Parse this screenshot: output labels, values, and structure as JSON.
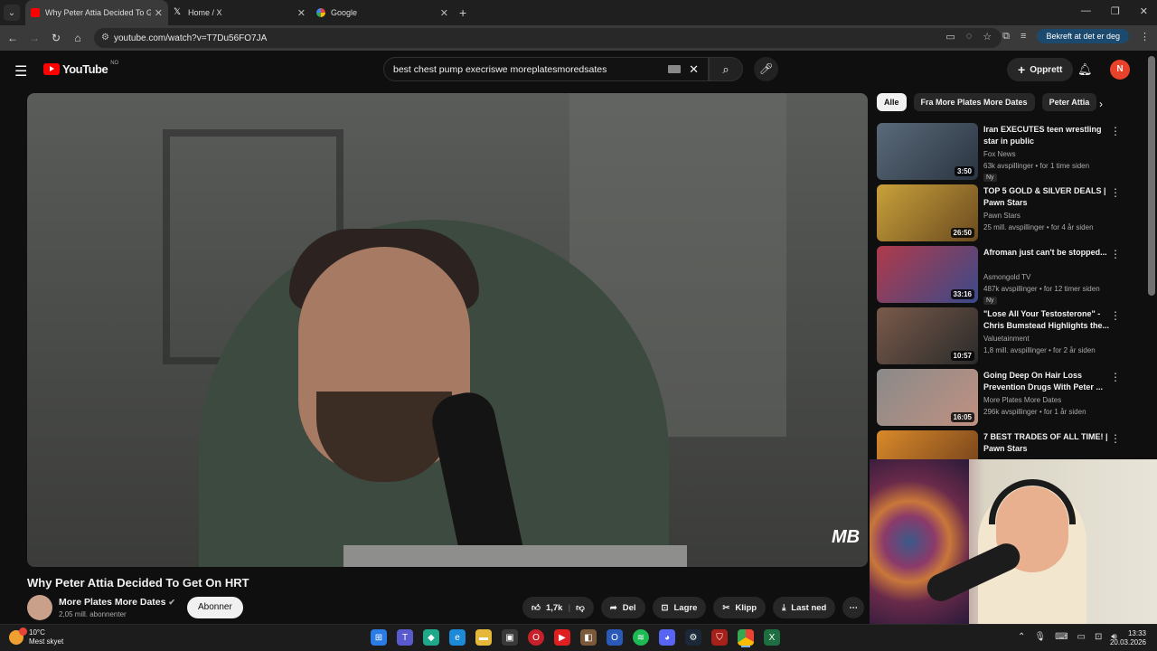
{
  "browser": {
    "tabs": [
      {
        "title": "Why Peter Attia Decided To Ge",
        "icon": "youtube-icon",
        "active": true
      },
      {
        "title": "Home / X",
        "icon": "x-icon",
        "active": false
      },
      {
        "title": "Google",
        "icon": "google-icon",
        "active": false
      }
    ],
    "url": "youtube.com/watch?v=T7Du56FO7JA",
    "verify_label": "Bekreft at det er deg"
  },
  "youtube": {
    "logo_text": "YouTube",
    "country_code": "NO",
    "search_value": "best chest pump execriswe moreplatesmoredsates",
    "create_label": "Opprett",
    "avatar_letter": "N",
    "accent": "#ff0000"
  },
  "video": {
    "title": "Why Peter Attia Decided To Get On HRT",
    "channel": "More Plates More Dates",
    "subscribers": "2,05 mill. abonnenter",
    "subscribe_label": "Abonner",
    "likes": "1,7k",
    "share_label": "Del",
    "save_label": "Lagre",
    "clip_label": "Klipp",
    "download_label": "Last ned",
    "watermark": "MB"
  },
  "chips": [
    "Alle",
    "Fra More Plates More Dates",
    "Peter Attia"
  ],
  "related": [
    {
      "title": "Iran EXECUTES teen wrestling star in public",
      "channel": "Fox News",
      "meta": "63k avspillinger • for 1 time siden",
      "badge": "Ny",
      "duration": "3:50",
      "colors": [
        "#5a6a7a",
        "#2a3440"
      ]
    },
    {
      "title": "TOP 5 GOLD & SILVER DEALS | Pawn Stars",
      "channel": "Pawn Stars",
      "meta": "25 mill. avspillinger • for 4 år siden",
      "badge": "",
      "duration": "26:50",
      "colors": [
        "#c9a13a",
        "#6a4a20"
      ]
    },
    {
      "title": "Afroman just can't be stopped...",
      "channel": "Asmongold TV",
      "meta": "487k avspillinger • for 12 timer siden",
      "badge": "Ny",
      "duration": "33:16",
      "colors": [
        "#b03a4a",
        "#3a4a8a"
      ]
    },
    {
      "title": "\"Lose All Your Testosterone\" - Chris Bumstead Highlights the...",
      "channel": "Valuetainment",
      "meta": "1,8 mill. avspillinger • for 2 år siden",
      "badge": "",
      "duration": "10:57",
      "colors": [
        "#7a5a4a",
        "#2a2a2a"
      ]
    },
    {
      "title": "Going Deep On Hair Loss Prevention Drugs With Peter ...",
      "channel": "More Plates More Dates",
      "meta": "296k avspillinger • for 1 år siden",
      "badge": "",
      "duration": "16:05",
      "colors": [
        "#8a8a8a",
        "#c09080"
      ]
    },
    {
      "title": "7 BEST TRADES OF ALL TIME! | Pawn Stars",
      "channel": "",
      "meta": "",
      "badge": "",
      "duration": "",
      "colors": [
        "#d98a2a",
        "#6a3a1a"
      ]
    }
  ],
  "taskbar": {
    "temperature": "10°C",
    "weather": "Mest skyet",
    "time": "13:33",
    "date": "20.03.2026"
  }
}
